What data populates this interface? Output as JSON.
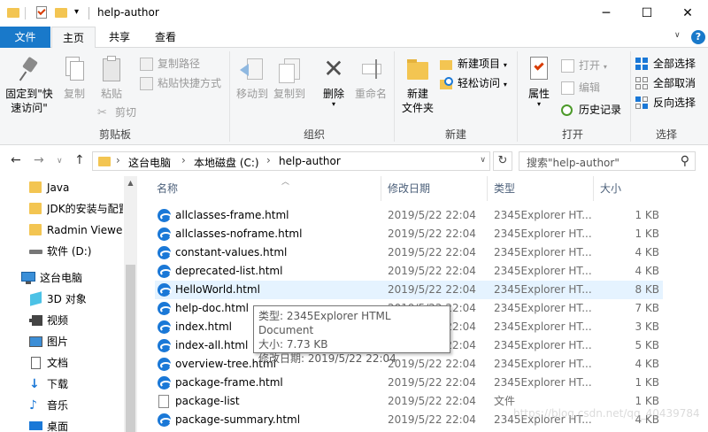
{
  "window": {
    "title": "help-author",
    "minimize": "─",
    "maximize": "☐",
    "close": "✕",
    "qa_dropdown": "▾"
  },
  "tabs": [
    {
      "label": "文件"
    },
    {
      "label": "主页"
    },
    {
      "label": "共享"
    },
    {
      "label": "查看"
    }
  ],
  "ribbon": {
    "clipboard": {
      "label": "剪贴板",
      "pin": "固定到\"快速访问\"",
      "copy": "复制",
      "paste": "粘贴",
      "copy_path": "复制路径",
      "paste_shortcut": "粘贴快捷方式",
      "cut": "剪切"
    },
    "organize": {
      "label": "组织",
      "move_to": "移动到",
      "copy_to": "复制到",
      "delete": "删除",
      "rename": "重命名"
    },
    "new": {
      "label": "新建",
      "new_folder": "新建\n文件夹",
      "new_item": "新建项目",
      "easy_access": "轻松访问"
    },
    "open": {
      "label": "打开",
      "properties": "属性",
      "open": "打开",
      "edit": "编辑",
      "history": "历史记录"
    },
    "select": {
      "label": "选择",
      "select_all": "全部选择",
      "select_none": "全部取消",
      "invert": "反向选择"
    }
  },
  "address": {
    "crumbs": [
      "这台电脑",
      "本地磁盘 (C:)",
      "help-author"
    ],
    "search_placeholder": "搜索\"help-author\""
  },
  "nav_pane": {
    "items": [
      {
        "label": "Java",
        "icon": "folder-icon"
      },
      {
        "label": "JDK的安装与配置",
        "icon": "folder-icon"
      },
      {
        "label": "Radmin Viewer",
        "icon": "folder-icon"
      },
      {
        "label": "软件 (D:)",
        "icon": "drive-icon"
      },
      {
        "label": "这台电脑",
        "icon": "computer-icon"
      },
      {
        "label": "3D 对象",
        "icon": "3d-objects-icon"
      },
      {
        "label": "视频",
        "icon": "video-icon"
      },
      {
        "label": "图片",
        "icon": "pictures-icon"
      },
      {
        "label": "文档",
        "icon": "documents-icon"
      },
      {
        "label": "下载",
        "icon": "download-icon"
      },
      {
        "label": "音乐",
        "icon": "music-icon"
      },
      {
        "label": "桌面",
        "icon": "desktop-icon"
      }
    ]
  },
  "columns": {
    "name": "名称",
    "date": "修改日期",
    "type": "类型",
    "size": "大小"
  },
  "files": [
    {
      "name": "allclasses-frame.html",
      "date": "2019/5/22 22:04",
      "type": "2345Explorer HT...",
      "size": "1 KB",
      "icon": "html-file-icon"
    },
    {
      "name": "allclasses-noframe.html",
      "date": "2019/5/22 22:04",
      "type": "2345Explorer HT...",
      "size": "1 KB",
      "icon": "html-file-icon"
    },
    {
      "name": "constant-values.html",
      "date": "2019/5/22 22:04",
      "type": "2345Explorer HT...",
      "size": "4 KB",
      "icon": "html-file-icon"
    },
    {
      "name": "deprecated-list.html",
      "date": "2019/5/22 22:04",
      "type": "2345Explorer HT...",
      "size": "4 KB",
      "icon": "html-file-icon"
    },
    {
      "name": "HelloWorld.html",
      "date": "2019/5/22 22:04",
      "type": "2345Explorer HT...",
      "size": "8 KB",
      "icon": "html-file-icon"
    },
    {
      "name": "help-doc.html",
      "date": "2019/5/22 22:04",
      "type": "2345Explorer HT...",
      "size": "7 KB",
      "icon": "html-file-icon"
    },
    {
      "name": "index.html",
      "date": "2019/5/22 22:04",
      "type": "2345Explorer HT...",
      "size": "3 KB",
      "icon": "html-file-icon"
    },
    {
      "name": "index-all.html",
      "date": "2019/5/22 22:04",
      "type": "2345Explorer HT...",
      "size": "5 KB",
      "icon": "html-file-icon"
    },
    {
      "name": "overview-tree.html",
      "date": "2019/5/22 22:04",
      "type": "2345Explorer HT...",
      "size": "4 KB",
      "icon": "html-file-icon"
    },
    {
      "name": "package-frame.html",
      "date": "2019/5/22 22:04",
      "type": "2345Explorer HT...",
      "size": "1 KB",
      "icon": "html-file-icon"
    },
    {
      "name": "package-list",
      "date": "2019/5/22 22:04",
      "type": "文件",
      "size": "1 KB",
      "icon": "generic-file-icon"
    },
    {
      "name": "package-summary.html",
      "date": "2019/5/22 22:04",
      "type": "2345Explorer HT...",
      "size": "4 KB",
      "icon": "html-file-icon"
    }
  ],
  "tooltip": {
    "type_line": "类型: 2345Explorer HTML Document",
    "size_line": "大小: 7.73 KB",
    "date_line": "修改日期: 2019/5/22 22:04"
  },
  "watermark": "https://blog.csdn.net/qq_40439784",
  "colors": {
    "accent": "#1979ca",
    "hover_row": "#e5f3ff",
    "folder": "#f3c552"
  }
}
